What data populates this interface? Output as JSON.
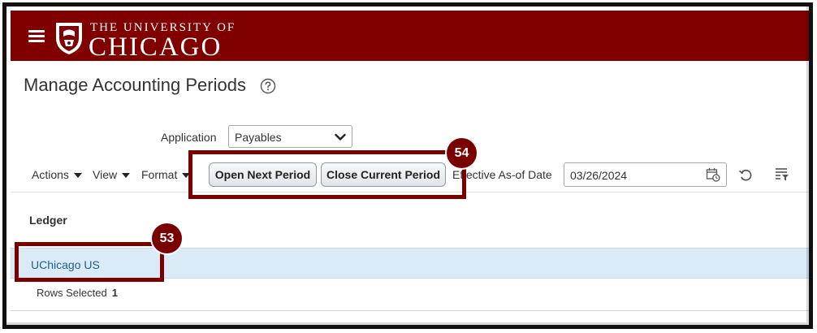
{
  "header": {
    "logo_line1": "THE UNIVERSITY OF",
    "logo_line2": "CHICAGO",
    "bg_color": "#800000"
  },
  "page": {
    "title": "Manage Accounting Periods",
    "help_icon": "help-circle-icon"
  },
  "filters": {
    "application_label": "Application",
    "application_value": "Payables"
  },
  "toolbar": {
    "actions_label": "Actions",
    "view_label": "View",
    "format_label": "Format",
    "open_next_period_label": "Open Next Period",
    "close_current_period_label": "Close Current Period",
    "effective_label": "Effective As-of Date",
    "effective_date": "03/26/2024",
    "icons": [
      "calendar-icon",
      "refresh-icon",
      "freeze-filter-icon"
    ]
  },
  "table": {
    "column_header": "Ledger",
    "rows": [
      {
        "ledger": "UChicago US",
        "selected": true
      }
    ],
    "rows_selected_label": "Rows Selected",
    "rows_selected_count": "1"
  },
  "annotations": {
    "callout_53": "53",
    "callout_54": "54",
    "color": "#7a0000"
  }
}
